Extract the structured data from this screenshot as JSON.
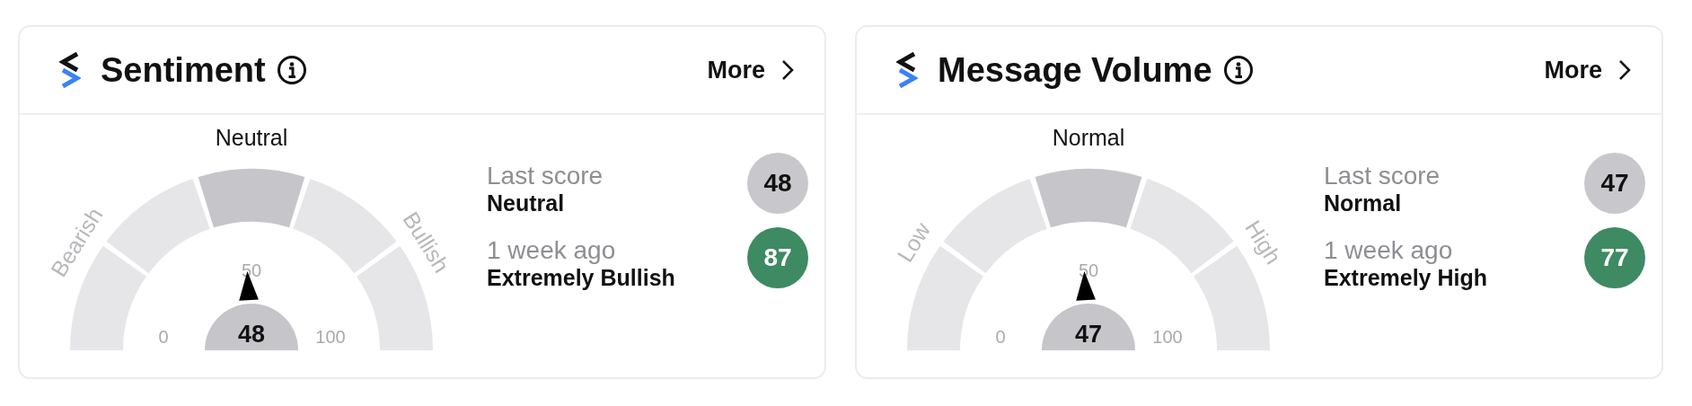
{
  "cards": [
    {
      "title": "Sentiment",
      "more": "More",
      "gauge": {
        "top_label": "Neutral",
        "left_label": "Bearish",
        "right_label": "Bullish",
        "ticks": [
          "0",
          "50",
          "100"
        ],
        "segments": [
          {
            "selected": false
          },
          {
            "selected": false
          },
          {
            "selected": true
          },
          {
            "selected": false
          },
          {
            "selected": false
          }
        ],
        "reading": "48"
      },
      "scores": [
        {
          "caption": "Last score",
          "label": "Neutral",
          "value": "48",
          "color": "#c8c8cc"
        },
        {
          "caption": "1 week ago",
          "label": "Extremely Bullish",
          "value": "87",
          "color": "#3e8a63"
        }
      ]
    },
    {
      "title": "Message Volume",
      "more": "More",
      "gauge": {
        "top_label": "Normal",
        "left_label": "Low",
        "right_label": "High",
        "ticks": [
          "0",
          "50",
          "100"
        ],
        "segments": [
          {
            "selected": false
          },
          {
            "selected": false
          },
          {
            "selected": true
          },
          {
            "selected": false
          },
          {
            "selected": false
          }
        ],
        "reading": "47"
      },
      "scores": [
        {
          "caption": "Last score",
          "label": "Normal",
          "value": "47",
          "color": "#c8c8cc"
        },
        {
          "caption": "1 week ago",
          "label": "Extremely High",
          "value": "77",
          "color": "#3e8a63"
        }
      ]
    }
  ]
}
